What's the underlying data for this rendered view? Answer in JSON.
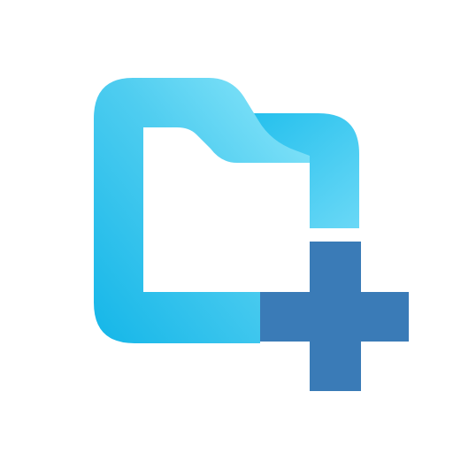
{
  "icon": {
    "name": "new-folder-icon",
    "parts": [
      "folder-icon",
      "plus-icon"
    ]
  },
  "colors": {
    "background": "#ffffff",
    "folder_light": "#8fe8fb",
    "folder_mid": "#3fc8ef",
    "folder_dark": "#14b6e8",
    "plus": "#3a7bb7"
  }
}
